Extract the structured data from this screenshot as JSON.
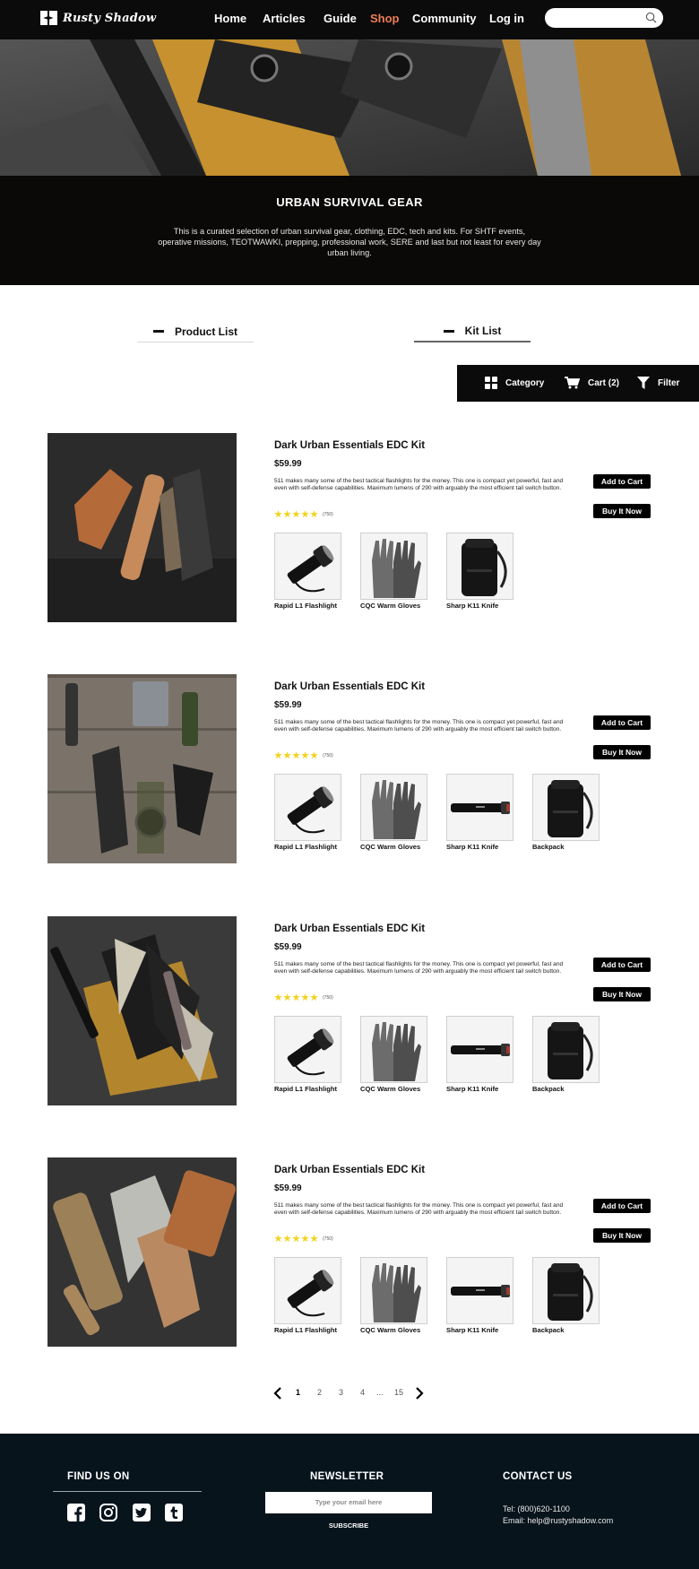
{
  "nav": {
    "brand": "Rusty Shadow",
    "links": [
      {
        "label": "Home",
        "active": false
      },
      {
        "label": "Articles",
        "active": false
      },
      {
        "label": "Guide",
        "active": false
      },
      {
        "label": "Shop",
        "active": true
      },
      {
        "label": "Community",
        "active": false
      },
      {
        "label": "Log in",
        "active": false
      }
    ],
    "search_placeholder": ""
  },
  "intro": {
    "title": "URBAN SURVIVAL GEAR",
    "text": "This is a curated selection of urban survival gear, clothing, EDC, tech and kits. For SHTF events, operative missions, TEOTWAWKI, prepping, professional work, SERE and last but not least for every day urban living."
  },
  "tabs": [
    {
      "label": "Product List",
      "active": false
    },
    {
      "label": "Kit List",
      "active": true
    }
  ],
  "filter_bar": {
    "category_label": "Category",
    "cart_label": "Cart (2)",
    "filter_label": "Filter"
  },
  "products": [
    {
      "title": "Dark Urban Essentials EDC Kit",
      "price": "$59.99",
      "description": "511 makes many some of the best tactical flashlights for the money. This one is compact yet powerful, fast and even with self-defense capabilities. Maximum lumens of 290 with arguably the most efficient tail switch button.",
      "rating": 5,
      "reviews": "(750)",
      "add_to_cart": "Add to Cart",
      "buy_now": "Buy It Now",
      "items": [
        "Rapid L1 Flashlight",
        "CQC Warm Gloves",
        "Sharp K11 Knife"
      ]
    },
    {
      "title": "Dark Urban Essentials EDC Kit",
      "price": "$59.99",
      "description": "511 makes many some of the best tactical flashlights for the money. This one is compact yet powerful, fast and even with self-defense capabilities. Maximum lumens of 290 with arguably the most efficient tail switch button.",
      "rating": 5,
      "reviews": "(750)",
      "add_to_cart": "Add to Cart",
      "buy_now": "Buy It Now",
      "items": [
        "Rapid L1 Flashlight",
        "CQC Warm Gloves",
        "Sharp K11 Knife",
        "Backpack"
      ]
    },
    {
      "title": "Dark Urban Essentials EDC Kit",
      "price": "$59.99",
      "description": "511 makes many some of the best tactical flashlights for the money. This one is compact yet powerful, fast and even with self-defense capabilities. Maximum lumens of 290 with arguably the most efficient tail switch button.",
      "rating": 5,
      "reviews": "(750)",
      "add_to_cart": "Add to Cart",
      "buy_now": "Buy It Now",
      "items": [
        "Rapid L1 Flashlight",
        "CQC Warm Gloves",
        "Sharp K11 Knife",
        "Backpack"
      ]
    },
    {
      "title": "Dark Urban Essentials EDC Kit",
      "price": "$59.99",
      "description": "511 makes many some of the best tactical flashlights for the money. This one is compact yet powerful, fast and even with self-defense capabilities. Maximum lumens of 290 with arguably the most efficient tail switch button.",
      "rating": 5,
      "reviews": "(750)",
      "add_to_cart": "Add to Cart",
      "buy_now": "Buy It Now",
      "items": [
        "Rapid L1 Flashlight",
        "CQC Warm Gloves",
        "Sharp K11 Knife",
        "Backpack"
      ]
    }
  ],
  "pagination": {
    "pages": [
      "1",
      "2",
      "3",
      "4",
      "...",
      "15"
    ],
    "current": "1"
  },
  "footer": {
    "find_us_title": "FIND US ON",
    "social_icons": [
      "facebook-icon",
      "instagram-icon",
      "twitter-icon",
      "tumblr-icon"
    ],
    "newsletter_title": "NEWSLETTER",
    "newsletter_placeholder": "Type your email here",
    "subscribe_label": "SUBSCRIBE",
    "contact_title": "CONTACT US",
    "tel": "Tel: (800)620-1100",
    "email": "Email: help@rustyshadow.com"
  },
  "colors": {
    "nav_bg": "#0b0b0b",
    "accent_active": "#f07d57",
    "star": "#f2d21a",
    "footer_bg": "#07141c"
  }
}
